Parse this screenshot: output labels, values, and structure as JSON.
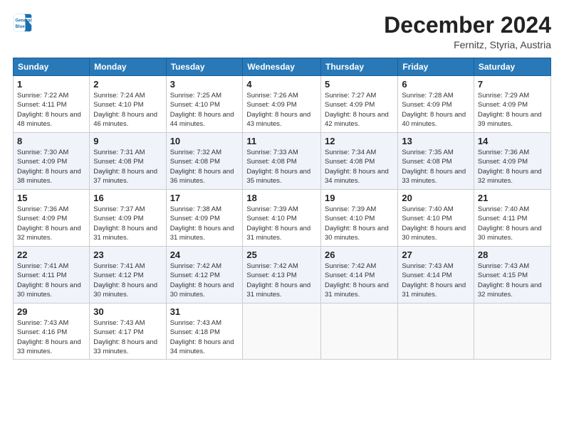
{
  "header": {
    "logo_line1": "General",
    "logo_line2": "Blue",
    "month": "December 2024",
    "location": "Fernitz, Styria, Austria"
  },
  "weekdays": [
    "Sunday",
    "Monday",
    "Tuesday",
    "Wednesday",
    "Thursday",
    "Friday",
    "Saturday"
  ],
  "weeks": [
    [
      {
        "day": "1",
        "sunrise": "7:22 AM",
        "sunset": "4:11 PM",
        "daylight": "8 hours and 48 minutes."
      },
      {
        "day": "2",
        "sunrise": "7:24 AM",
        "sunset": "4:10 PM",
        "daylight": "8 hours and 46 minutes."
      },
      {
        "day": "3",
        "sunrise": "7:25 AM",
        "sunset": "4:10 PM",
        "daylight": "8 hours and 44 minutes."
      },
      {
        "day": "4",
        "sunrise": "7:26 AM",
        "sunset": "4:09 PM",
        "daylight": "8 hours and 43 minutes."
      },
      {
        "day": "5",
        "sunrise": "7:27 AM",
        "sunset": "4:09 PM",
        "daylight": "8 hours and 42 minutes."
      },
      {
        "day": "6",
        "sunrise": "7:28 AM",
        "sunset": "4:09 PM",
        "daylight": "8 hours and 40 minutes."
      },
      {
        "day": "7",
        "sunrise": "7:29 AM",
        "sunset": "4:09 PM",
        "daylight": "8 hours and 39 minutes."
      }
    ],
    [
      {
        "day": "8",
        "sunrise": "7:30 AM",
        "sunset": "4:09 PM",
        "daylight": "8 hours and 38 minutes."
      },
      {
        "day": "9",
        "sunrise": "7:31 AM",
        "sunset": "4:08 PM",
        "daylight": "8 hours and 37 minutes."
      },
      {
        "day": "10",
        "sunrise": "7:32 AM",
        "sunset": "4:08 PM",
        "daylight": "8 hours and 36 minutes."
      },
      {
        "day": "11",
        "sunrise": "7:33 AM",
        "sunset": "4:08 PM",
        "daylight": "8 hours and 35 minutes."
      },
      {
        "day": "12",
        "sunrise": "7:34 AM",
        "sunset": "4:08 PM",
        "daylight": "8 hours and 34 minutes."
      },
      {
        "day": "13",
        "sunrise": "7:35 AM",
        "sunset": "4:08 PM",
        "daylight": "8 hours and 33 minutes."
      },
      {
        "day": "14",
        "sunrise": "7:36 AM",
        "sunset": "4:09 PM",
        "daylight": "8 hours and 32 minutes."
      }
    ],
    [
      {
        "day": "15",
        "sunrise": "7:36 AM",
        "sunset": "4:09 PM",
        "daylight": "8 hours and 32 minutes."
      },
      {
        "day": "16",
        "sunrise": "7:37 AM",
        "sunset": "4:09 PM",
        "daylight": "8 hours and 31 minutes."
      },
      {
        "day": "17",
        "sunrise": "7:38 AM",
        "sunset": "4:09 PM",
        "daylight": "8 hours and 31 minutes."
      },
      {
        "day": "18",
        "sunrise": "7:39 AM",
        "sunset": "4:10 PM",
        "daylight": "8 hours and 31 minutes."
      },
      {
        "day": "19",
        "sunrise": "7:39 AM",
        "sunset": "4:10 PM",
        "daylight": "8 hours and 30 minutes."
      },
      {
        "day": "20",
        "sunrise": "7:40 AM",
        "sunset": "4:10 PM",
        "daylight": "8 hours and 30 minutes."
      },
      {
        "day": "21",
        "sunrise": "7:40 AM",
        "sunset": "4:11 PM",
        "daylight": "8 hours and 30 minutes."
      }
    ],
    [
      {
        "day": "22",
        "sunrise": "7:41 AM",
        "sunset": "4:11 PM",
        "daylight": "8 hours and 30 minutes."
      },
      {
        "day": "23",
        "sunrise": "7:41 AM",
        "sunset": "4:12 PM",
        "daylight": "8 hours and 30 minutes."
      },
      {
        "day": "24",
        "sunrise": "7:42 AM",
        "sunset": "4:12 PM",
        "daylight": "8 hours and 30 minutes."
      },
      {
        "day": "25",
        "sunrise": "7:42 AM",
        "sunset": "4:13 PM",
        "daylight": "8 hours and 31 minutes."
      },
      {
        "day": "26",
        "sunrise": "7:42 AM",
        "sunset": "4:14 PM",
        "daylight": "8 hours and 31 minutes."
      },
      {
        "day": "27",
        "sunrise": "7:43 AM",
        "sunset": "4:14 PM",
        "daylight": "8 hours and 31 minutes."
      },
      {
        "day": "28",
        "sunrise": "7:43 AM",
        "sunset": "4:15 PM",
        "daylight": "8 hours and 32 minutes."
      }
    ],
    [
      {
        "day": "29",
        "sunrise": "7:43 AM",
        "sunset": "4:16 PM",
        "daylight": "8 hours and 33 minutes."
      },
      {
        "day": "30",
        "sunrise": "7:43 AM",
        "sunset": "4:17 PM",
        "daylight": "8 hours and 33 minutes."
      },
      {
        "day": "31",
        "sunrise": "7:43 AM",
        "sunset": "4:18 PM",
        "daylight": "8 hours and 34 minutes."
      },
      null,
      null,
      null,
      null
    ]
  ]
}
